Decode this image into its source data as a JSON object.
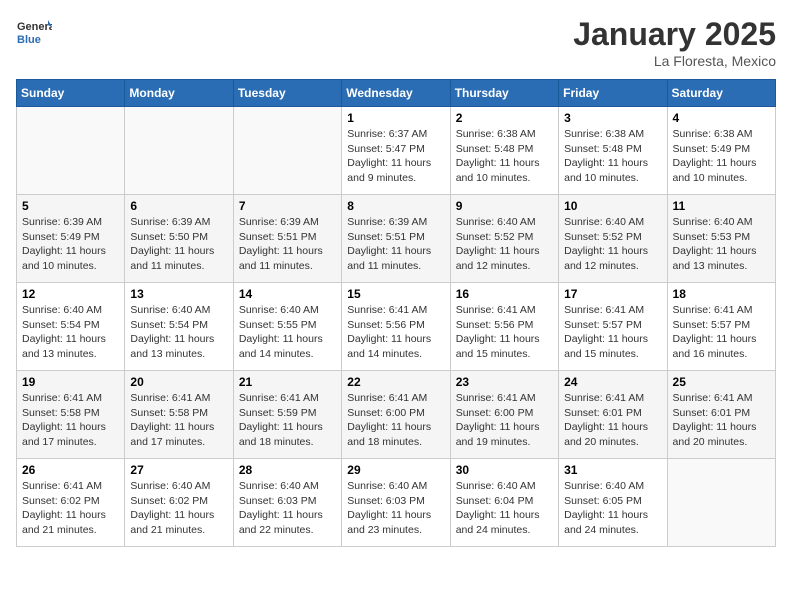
{
  "header": {
    "logo_general": "General",
    "logo_blue": "Blue",
    "month_title": "January 2025",
    "location": "La Floresta, Mexico"
  },
  "weekdays": [
    "Sunday",
    "Monday",
    "Tuesday",
    "Wednesday",
    "Thursday",
    "Friday",
    "Saturday"
  ],
  "weeks": [
    [
      {
        "day": "",
        "info": ""
      },
      {
        "day": "",
        "info": ""
      },
      {
        "day": "",
        "info": ""
      },
      {
        "day": "1",
        "info": "Sunrise: 6:37 AM\nSunset: 5:47 PM\nDaylight: 11 hours and 9 minutes."
      },
      {
        "day": "2",
        "info": "Sunrise: 6:38 AM\nSunset: 5:48 PM\nDaylight: 11 hours and 10 minutes."
      },
      {
        "day": "3",
        "info": "Sunrise: 6:38 AM\nSunset: 5:48 PM\nDaylight: 11 hours and 10 minutes."
      },
      {
        "day": "4",
        "info": "Sunrise: 6:38 AM\nSunset: 5:49 PM\nDaylight: 11 hours and 10 minutes."
      }
    ],
    [
      {
        "day": "5",
        "info": "Sunrise: 6:39 AM\nSunset: 5:49 PM\nDaylight: 11 hours and 10 minutes."
      },
      {
        "day": "6",
        "info": "Sunrise: 6:39 AM\nSunset: 5:50 PM\nDaylight: 11 hours and 11 minutes."
      },
      {
        "day": "7",
        "info": "Sunrise: 6:39 AM\nSunset: 5:51 PM\nDaylight: 11 hours and 11 minutes."
      },
      {
        "day": "8",
        "info": "Sunrise: 6:39 AM\nSunset: 5:51 PM\nDaylight: 11 hours and 11 minutes."
      },
      {
        "day": "9",
        "info": "Sunrise: 6:40 AM\nSunset: 5:52 PM\nDaylight: 11 hours and 12 minutes."
      },
      {
        "day": "10",
        "info": "Sunrise: 6:40 AM\nSunset: 5:52 PM\nDaylight: 11 hours and 12 minutes."
      },
      {
        "day": "11",
        "info": "Sunrise: 6:40 AM\nSunset: 5:53 PM\nDaylight: 11 hours and 13 minutes."
      }
    ],
    [
      {
        "day": "12",
        "info": "Sunrise: 6:40 AM\nSunset: 5:54 PM\nDaylight: 11 hours and 13 minutes."
      },
      {
        "day": "13",
        "info": "Sunrise: 6:40 AM\nSunset: 5:54 PM\nDaylight: 11 hours and 13 minutes."
      },
      {
        "day": "14",
        "info": "Sunrise: 6:40 AM\nSunset: 5:55 PM\nDaylight: 11 hours and 14 minutes."
      },
      {
        "day": "15",
        "info": "Sunrise: 6:41 AM\nSunset: 5:56 PM\nDaylight: 11 hours and 14 minutes."
      },
      {
        "day": "16",
        "info": "Sunrise: 6:41 AM\nSunset: 5:56 PM\nDaylight: 11 hours and 15 minutes."
      },
      {
        "day": "17",
        "info": "Sunrise: 6:41 AM\nSunset: 5:57 PM\nDaylight: 11 hours and 15 minutes."
      },
      {
        "day": "18",
        "info": "Sunrise: 6:41 AM\nSunset: 5:57 PM\nDaylight: 11 hours and 16 minutes."
      }
    ],
    [
      {
        "day": "19",
        "info": "Sunrise: 6:41 AM\nSunset: 5:58 PM\nDaylight: 11 hours and 17 minutes."
      },
      {
        "day": "20",
        "info": "Sunrise: 6:41 AM\nSunset: 5:58 PM\nDaylight: 11 hours and 17 minutes."
      },
      {
        "day": "21",
        "info": "Sunrise: 6:41 AM\nSunset: 5:59 PM\nDaylight: 11 hours and 18 minutes."
      },
      {
        "day": "22",
        "info": "Sunrise: 6:41 AM\nSunset: 6:00 PM\nDaylight: 11 hours and 18 minutes."
      },
      {
        "day": "23",
        "info": "Sunrise: 6:41 AM\nSunset: 6:00 PM\nDaylight: 11 hours and 19 minutes."
      },
      {
        "day": "24",
        "info": "Sunrise: 6:41 AM\nSunset: 6:01 PM\nDaylight: 11 hours and 20 minutes."
      },
      {
        "day": "25",
        "info": "Sunrise: 6:41 AM\nSunset: 6:01 PM\nDaylight: 11 hours and 20 minutes."
      }
    ],
    [
      {
        "day": "26",
        "info": "Sunrise: 6:41 AM\nSunset: 6:02 PM\nDaylight: 11 hours and 21 minutes."
      },
      {
        "day": "27",
        "info": "Sunrise: 6:40 AM\nSunset: 6:02 PM\nDaylight: 11 hours and 21 minutes."
      },
      {
        "day": "28",
        "info": "Sunrise: 6:40 AM\nSunset: 6:03 PM\nDaylight: 11 hours and 22 minutes."
      },
      {
        "day": "29",
        "info": "Sunrise: 6:40 AM\nSunset: 6:03 PM\nDaylight: 11 hours and 23 minutes."
      },
      {
        "day": "30",
        "info": "Sunrise: 6:40 AM\nSunset: 6:04 PM\nDaylight: 11 hours and 24 minutes."
      },
      {
        "day": "31",
        "info": "Sunrise: 6:40 AM\nSunset: 6:05 PM\nDaylight: 11 hours and 24 minutes."
      },
      {
        "day": "",
        "info": ""
      }
    ]
  ]
}
